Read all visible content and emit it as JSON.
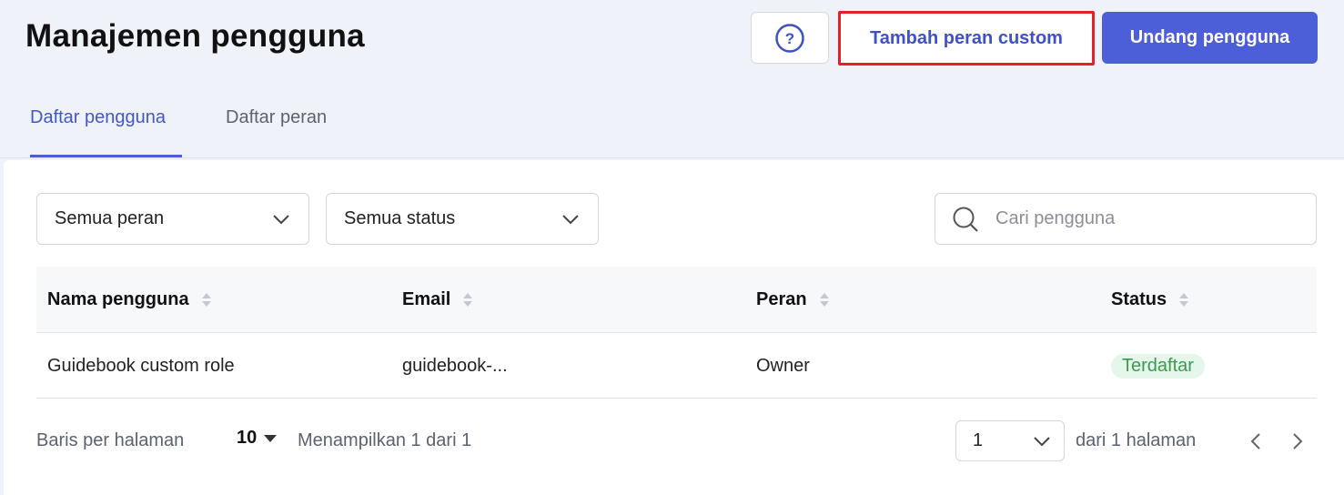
{
  "header": {
    "title": "Manajemen pengguna",
    "help_glyph": "?",
    "custom_role_label": "Tambah peran custom",
    "invite_label": "Undang pengguna"
  },
  "tabs": [
    {
      "label": "Daftar pengguna",
      "active": true
    },
    {
      "label": "Daftar peran",
      "active": false
    }
  ],
  "filters": {
    "role_value": "Semua peran",
    "status_value": "Semua status",
    "search_placeholder": "Cari pengguna"
  },
  "table": {
    "columns": [
      "Nama pengguna",
      "Email",
      "Peran",
      "Status"
    ],
    "rows": [
      {
        "name": "Guidebook custom role",
        "email": "guidebook-...",
        "role": "Owner",
        "status": "Terdaftar"
      }
    ]
  },
  "footer": {
    "rows_label": "Baris per halaman",
    "rows_value": "10",
    "showing": "Menampilkan 1 dari 1",
    "page_value": "1",
    "page_of": "dari 1 halaman"
  },
  "colors": {
    "accent": "#4d5fd8",
    "highlight_border": "#e4202a",
    "status_green": "#3b9a4f"
  },
  "icons": {
    "help": "question-circle-icon",
    "search": "search-icon",
    "dropdown": "chevron-down-icon",
    "prev": "chevron-left-icon",
    "next": "chevron-right-icon",
    "sort": "sort-icon"
  }
}
